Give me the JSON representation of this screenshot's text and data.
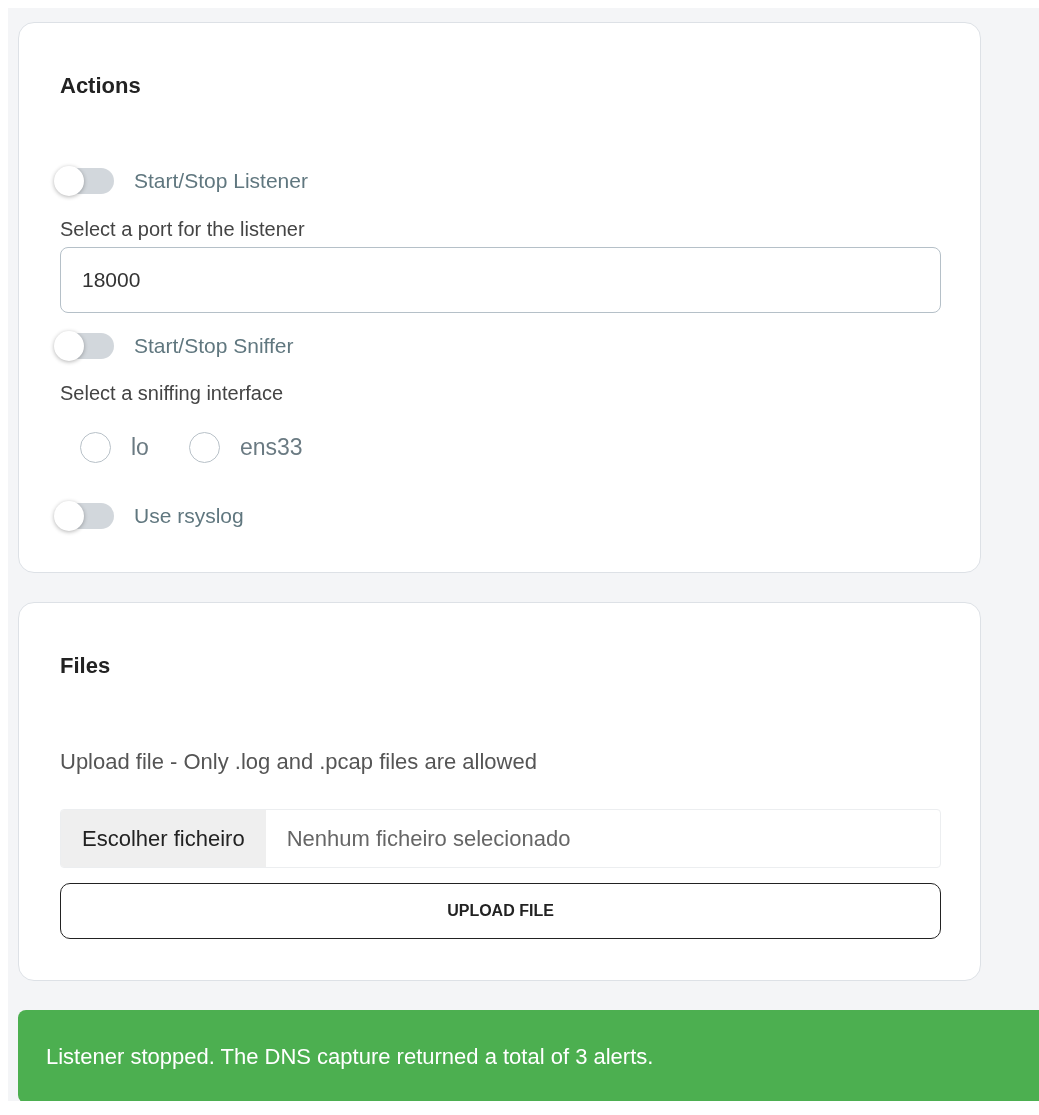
{
  "actions": {
    "title": "Actions",
    "controls": [
      {
        "kind": "switch",
        "label": "Start/Stop Listener",
        "on": false
      },
      {
        "kind": "field",
        "label": "Select a port for the listener",
        "value": "18000"
      },
      {
        "kind": "switch",
        "label": "Start/Stop Sniffer",
        "on": false
      },
      {
        "kind": "radios",
        "label": "Select a sniffing interface",
        "options": [
          {
            "label": "lo",
            "selected": false
          },
          {
            "label": "ens33",
            "selected": false
          }
        ]
      },
      {
        "kind": "switch",
        "label": "Use rsyslog",
        "on": false
      }
    ]
  },
  "files": {
    "title": "Files",
    "hint": "Upload file - Only .log and .pcap files are allowed",
    "file_input": {
      "button": "Escolher ficheiro",
      "status": "Nenhum ficheiro selecionado"
    },
    "upload_button": "UPLOAD FILE"
  },
  "alert": {
    "kind": "success",
    "text": "Listener stopped. The DNS capture returned a total of 3 alerts."
  }
}
